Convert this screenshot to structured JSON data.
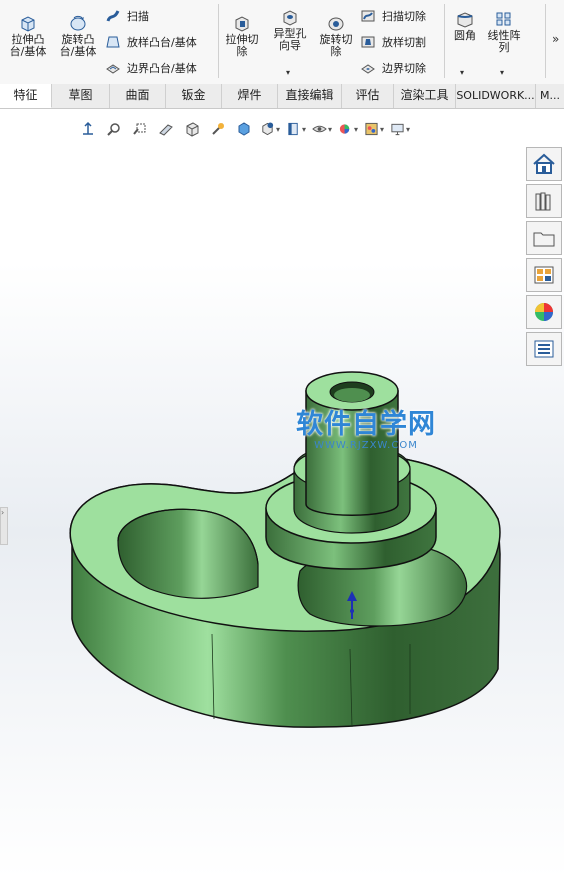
{
  "ribbon": {
    "extrude_boss": "拉伸凸\n台/基体",
    "revolve_boss": "旋转凸\n台/基体",
    "sweep": "扫描",
    "loft_boss": "放样凸台/基体",
    "boundary_boss": "边界凸台/基体",
    "extrude_cut": "拉伸切\n除",
    "hole_wizard": "异型孔\n向导",
    "revolve_cut": "旋转切\n除",
    "swept_cut": "扫描切除",
    "lofted_cut": "放样切割",
    "boundary_cut": "边界切除",
    "fillet": "圆角",
    "linear_pattern": "线性阵\n列"
  },
  "tabs": [
    "特征",
    "草图",
    "曲面",
    "钣金",
    "焊件",
    "直接编辑",
    "评估",
    "渲染工具",
    "SOLIDWORK...",
    "M..."
  ],
  "watermark": {
    "title": "软件自学网",
    "subtitle": "WWW.RJZXW.COM"
  },
  "colors": {
    "part_green": "#8fd58f",
    "watermark_blue": "#2f86d6"
  }
}
